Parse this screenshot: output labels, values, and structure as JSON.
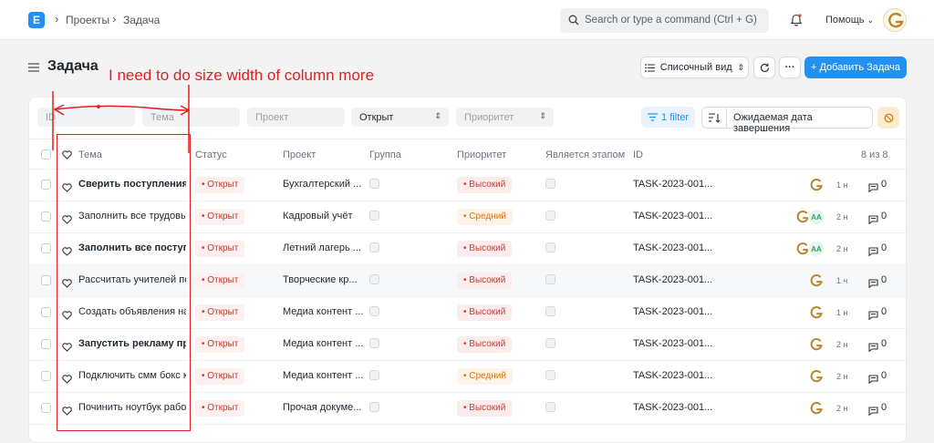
{
  "topbar": {
    "logo_letter": "E",
    "breadcrumbs": [
      "Проекты",
      "Задача"
    ],
    "search_placeholder": "Search or type a command (Ctrl + G)",
    "help_label": "Помощь"
  },
  "page": {
    "title": "Задача",
    "view_label": "Списочный вид",
    "add_label": "+ Добавить Задача",
    "more_label": "···"
  },
  "filters": {
    "id_placeholder": "ID",
    "subject_placeholder": "Тема",
    "project_placeholder": "Проект",
    "status_value": "Открыт",
    "priority_placeholder": "Приоритет",
    "filter_label": "1 filter",
    "sort_label": "Ожидаемая дата завершения"
  },
  "table": {
    "headers": {
      "subject": "Тема",
      "status": "Статус",
      "project": "Проект",
      "group": "Группа",
      "priority": "Приоритет",
      "milestone": "Является этапом",
      "id": "ID",
      "count": "8 из 8"
    },
    "rows": [
      {
        "subject": "Сверить поступления з",
        "status": "• Открыт",
        "project": "Бухгалтерский ...",
        "priority": "• Высокий",
        "priority_level": "high",
        "id": "TASK-2023-001...",
        "time": "1 н",
        "comments": "0",
        "bold": true,
        "aa": false
      },
      {
        "subject": "Заполнить все трудовы",
        "status": "• Открыт",
        "project": "Кадровый учёт",
        "priority": "• Средний",
        "priority_level": "mid",
        "id": "TASK-2023-001...",
        "time": "2 н",
        "comments": "0",
        "bold": false,
        "aa": true
      },
      {
        "subject": "Заполнить все поступл",
        "status": "• Открыт",
        "project": "Летний лагерь ...",
        "priority": "• Высокий",
        "priority_level": "high",
        "id": "TASK-2023-001...",
        "time": "2 н",
        "comments": "0",
        "bold": true,
        "aa": true
      },
      {
        "subject": "Рассчитать учителей по",
        "status": "• Открыт",
        "project": "Творческие кр...",
        "priority": "• Высокий",
        "priority_level": "high",
        "id": "TASK-2023-001...",
        "time": "1 ч",
        "comments": "0",
        "bold": false,
        "aa": false
      },
      {
        "subject": "Создать объявления на",
        "status": "• Открыт",
        "project": "Медиа контент ...",
        "priority": "• Высокий",
        "priority_level": "high",
        "id": "TASK-2023-001...",
        "time": "1 н",
        "comments": "0",
        "bold": false,
        "aa": false
      },
      {
        "subject": "Запустить рекламу про",
        "status": "• Открыт",
        "project": "Медиа контент ...",
        "priority": "• Высокий",
        "priority_level": "high",
        "id": "TASK-2023-001...",
        "time": "2 н",
        "comments": "0",
        "bold": true,
        "aa": false
      },
      {
        "subject": "Подключить смм бокс к",
        "status": "• Открыт",
        "project": "Медиа контент ...",
        "priority": "• Средний",
        "priority_level": "mid",
        "id": "TASK-2023-001...",
        "time": "2 н",
        "comments": "0",
        "bold": false,
        "aa": false
      },
      {
        "subject": "Починить ноутбук рабо",
        "status": "• Открыт",
        "project": "Прочая докуме...",
        "priority": "• Высокий",
        "priority_level": "high",
        "id": "TASK-2023-001...",
        "time": "2 н",
        "comments": "0",
        "bold": false,
        "aa": false
      }
    ],
    "aa_initials": "АА"
  },
  "annotation": {
    "text": "I need to do size width of column more"
  },
  "colors": {
    "accent": "#2490ef",
    "annotation": "#e02020",
    "status_red": "#c0392b",
    "priority_mid": "#d9730d"
  }
}
